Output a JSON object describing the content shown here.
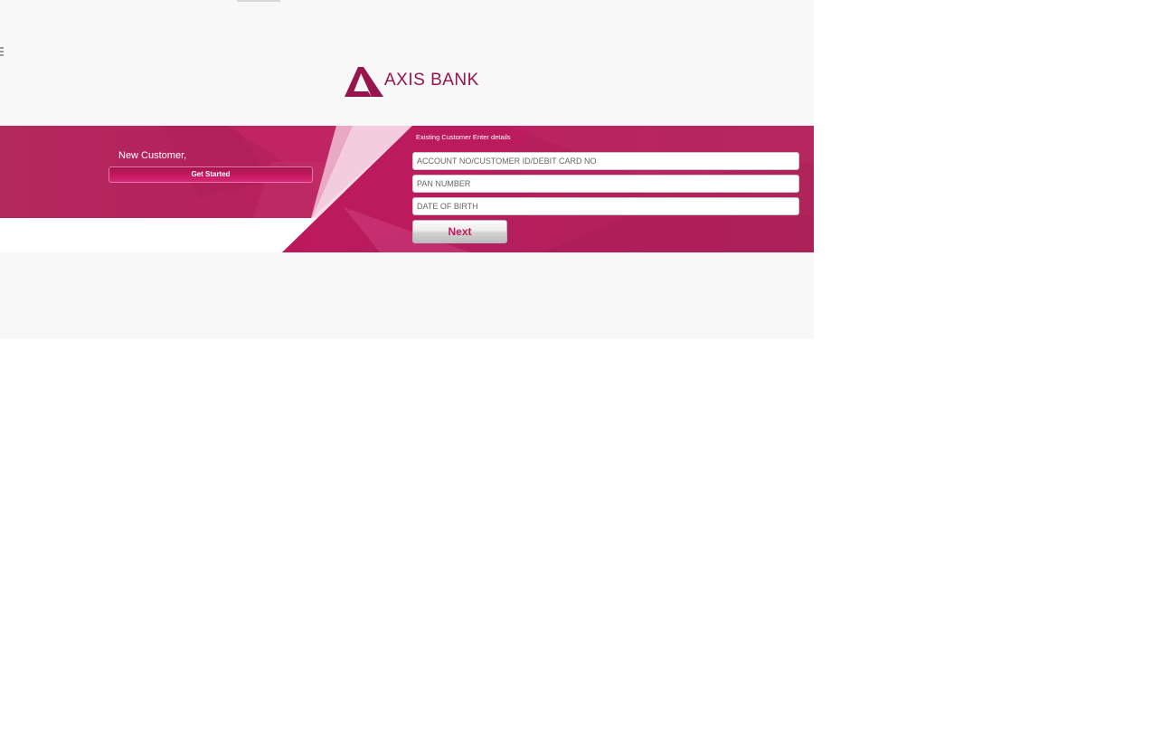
{
  "brand": {
    "name": "AXIS BANK",
    "color": "#97144d",
    "accent": "#b0245c"
  },
  "new_customer": {
    "label": "New Customer,",
    "button_label": "Get Started"
  },
  "existing_customer": {
    "label": "Existing Customer Enter details",
    "fields": [
      {
        "name": "account",
        "placeholder": "ACCOUNT NO/CUSTOMER ID/DEBIT CARD NO",
        "value": ""
      },
      {
        "name": "pan",
        "placeholder": "PAN NUMBER",
        "value": ""
      },
      {
        "name": "dob",
        "placeholder": "DATE OF BIRTH",
        "value": ""
      }
    ],
    "next_label": "Next"
  }
}
